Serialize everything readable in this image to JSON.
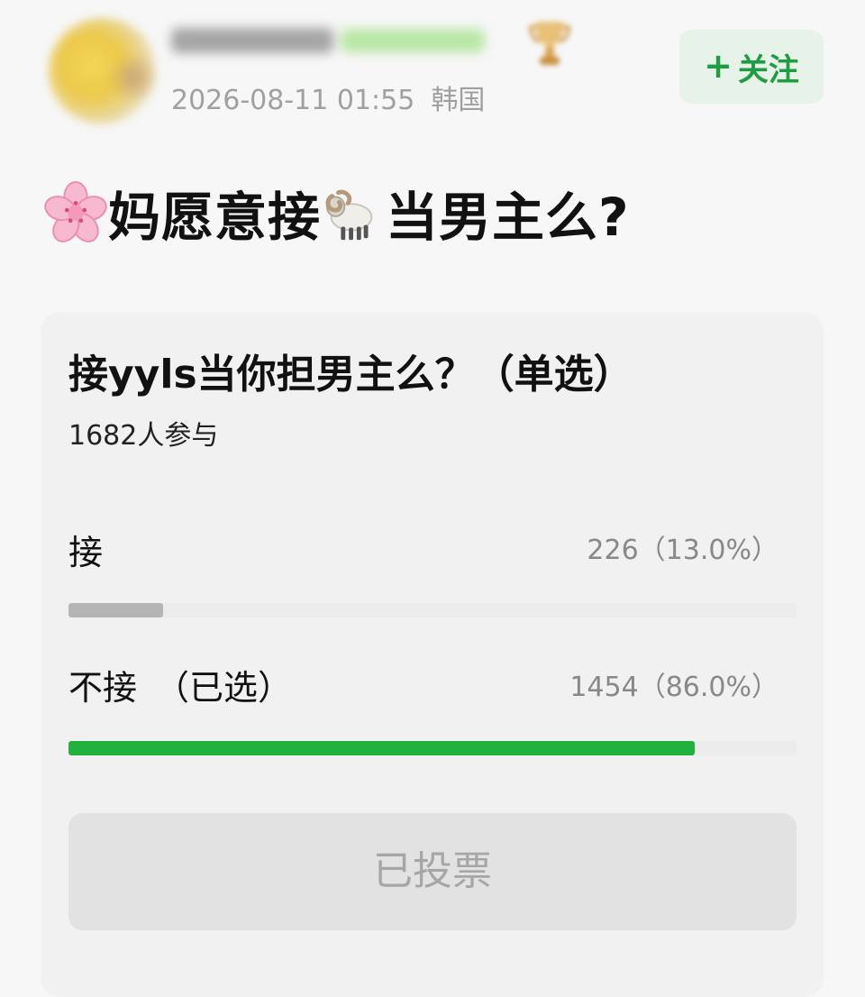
{
  "author": {
    "name": "",
    "timestamp": "2026-08-11 01:55",
    "location": "韩国",
    "follow_label": "关注",
    "follow_icon": "+"
  },
  "post": {
    "title_part1": "妈愿意接",
    "title_part2": "当男主么?",
    "leading_emoji": "cherry-blossom-icon",
    "inline_emoji": "ram-icon"
  },
  "poll": {
    "question": "接yyls当你担男主么？（单选）",
    "participants": "1682人参与",
    "options": [
      {
        "label": "接",
        "selected_tag": "",
        "value_text": "226（13.0%）",
        "percent": 13.0,
        "color": "#b5b5b5"
      },
      {
        "label": "不接",
        "selected_tag": "（已选）",
        "value_text": "1454（86.0%）",
        "percent": 86.0,
        "color": "#22b13d"
      }
    ],
    "voted_label": "已投票"
  },
  "colors": {
    "accent_green": "#1f9d43",
    "follow_background": "#e7f2e9",
    "muted_text": "#a0a0a0",
    "card_background": "#f1f1f1",
    "voted_button_background": "#e2e2e2"
  }
}
